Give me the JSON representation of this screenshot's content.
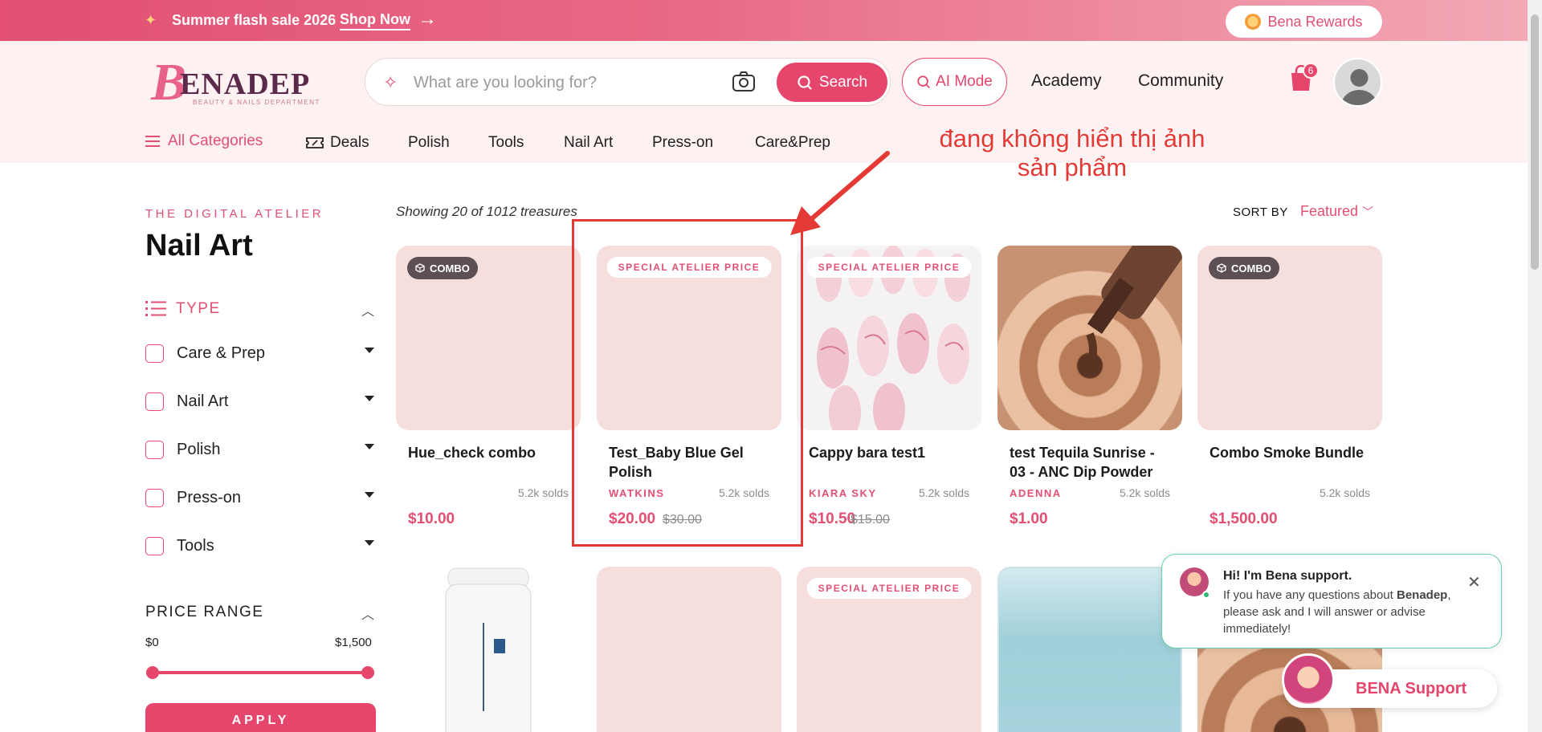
{
  "promo": {
    "text": "Summer flash sale 2026",
    "cta": "Shop Now"
  },
  "rewards": {
    "label": "Bena Rewards"
  },
  "logo": {
    "initial": "B",
    "word": "ENADEP",
    "tagline": "BEAUTY & NAILS DEPARTMENT"
  },
  "search": {
    "placeholder": "What are you looking for?",
    "button": "Search"
  },
  "header": {
    "ai_mode": "AI Mode",
    "academy": "Academy",
    "community": "Community",
    "cart_count": "6"
  },
  "categories": {
    "all": "All Categories",
    "items": [
      "Deals",
      "Polish",
      "Tools",
      "Nail Art",
      "Press-on",
      "Care&Prep"
    ]
  },
  "sidebar": {
    "eyebrow": "THE DIGITAL ATELIER",
    "title": "Nail Art",
    "type_heading": "TYPE",
    "types": [
      "Care & Prep",
      "Nail Art",
      "Polish",
      "Press-on",
      "Tools"
    ],
    "price_heading": "PRICE RANGE",
    "price_min": "$0",
    "price_max": "$1,500",
    "apply": "APPLY"
  },
  "results": {
    "showing": "Showing 20 of 1012 treasures",
    "sort_label": "SORT BY",
    "sort_value": "Featured"
  },
  "products": [
    {
      "name": "Hue_check combo",
      "brand": "",
      "sold": "5.2k solds",
      "price": "$10.00",
      "old_price": "",
      "badge": "COMBO"
    },
    {
      "name": "Test_Baby Blue Gel Polish",
      "brand": "WATKINS",
      "sold": "5.2k solds",
      "price": "$20.00",
      "old_price": "$30.00",
      "badge": "SPECIAL ATELIER PRICE"
    },
    {
      "name": "Cappy bara test1",
      "brand": "KIARA SKY",
      "sold": "5.2k solds",
      "price": "$10.50",
      "old_price": "$15.00",
      "badge": "SPECIAL ATELIER PRICE"
    },
    {
      "name": "test Tequila Sunrise - 03 - ANC Dip Powder",
      "brand": "ADENNA",
      "sold": "5.2k solds",
      "price": "$1.00",
      "old_price": "",
      "badge": ""
    },
    {
      "name": "Combo Smoke Bundle",
      "brand": "",
      "sold": "5.2k solds",
      "price": "$1,500.00",
      "old_price": "",
      "badge": "COMBO"
    }
  ],
  "row2_badges": {
    "third": "SPECIAL ATELIER PRICE"
  },
  "annotation": {
    "line1": "đang không hiển thị ảnh",
    "line2": "sản phẩm"
  },
  "chat": {
    "greeting": "Hi! I'm Bena support.",
    "message_a": "If you have any questions about ",
    "message_brand": "Benadep",
    "message_b": ", please ask and I will answer or advise immediately!",
    "support_label": "BENA Support"
  },
  "colors": {
    "accent": "#e6456c",
    "header_bg": "#fdf1f2",
    "annotation": "#e53935"
  }
}
